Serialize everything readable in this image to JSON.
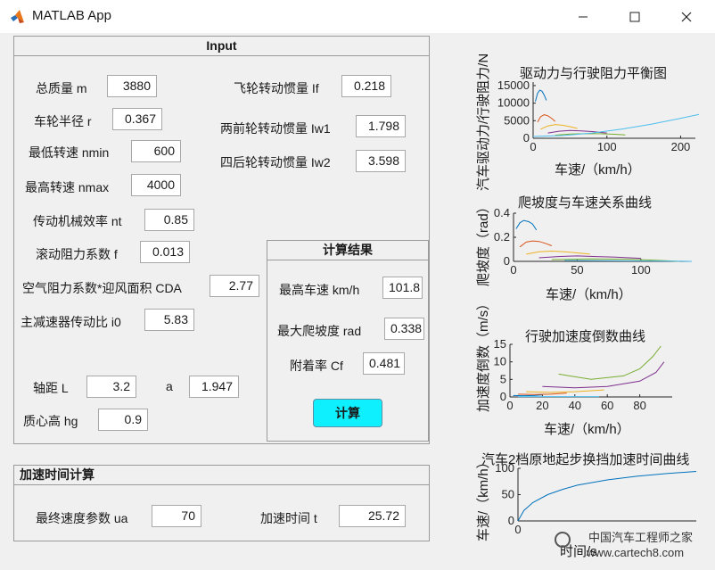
{
  "window": {
    "title": "MATLAB App",
    "minimize": "—",
    "maximize": "☐",
    "close": "✕"
  },
  "input_panel": {
    "title": "Input",
    "mass_label": "总质量 m",
    "mass": "3880",
    "wheel_radius_label": "车轮半径 r",
    "wheel_radius": "0.367",
    "nmin_label": "最低转速 nmin",
    "nmin": "600",
    "nmax_label": "最高转速 nmax",
    "nmax": "4000",
    "efficiency_label": "传动机械效率 nt",
    "efficiency": "0.85",
    "rolling_label": "滚动阻力系数 f",
    "rolling": "0.013",
    "cda_label": "空气阻力系数*迎风面积 CDA",
    "cda": "2.77",
    "i0_label": "主减速器传动比 i0",
    "i0": "5.83",
    "wheelbase_label": "轴距 L",
    "wheelbase": "3.2",
    "a_label": "a",
    "a": "1.947",
    "hg_label": "质心高 hg",
    "hg": "0.9",
    "flywheel_label": "飞轮转动惯量 If",
    "flywheel": "0.218",
    "front_inertia_label": "两前轮转动惯量 Iw1",
    "front_inertia": "1.798",
    "rear_inertia_label": "四后轮转动惯量 Iw2",
    "rear_inertia": "3.598"
  },
  "results_panel": {
    "title": "计算结果",
    "vmax_label": "最高车速 km/h",
    "vmax": "101.8",
    "grade_label": "最大爬坡度 rad",
    "grade": "0.338",
    "cf_label": "附着率 Cf",
    "cf": "0.481",
    "button": "计算"
  },
  "accel_panel": {
    "title": "加速时间计算",
    "ua_label": "最终速度参数 ua",
    "ua": "70",
    "time_label": "加速时间 t",
    "time": "25.72"
  },
  "colors": {
    "blue": "#0072bd",
    "orange": "#d95319",
    "yellow": "#edb120",
    "purple": "#7e2f8e",
    "green": "#77ac30",
    "cyan": "#4dbeee",
    "button": "#0ff0ff"
  },
  "chart_data": [
    {
      "type": "line",
      "title": "驱动力与行驶阻力平衡图",
      "xlabel": "车速/（km/h）",
      "ylabel": "汽车驱动力/行驶阻力/N",
      "xlim": [
        0,
        220
      ],
      "ylim": [
        0,
        16000
      ],
      "xticks": [
        "0",
        "100",
        "200"
      ],
      "yticks": [
        "0",
        "5000",
        "10000",
        "15000"
      ],
      "series": [
        {
          "color": "#0072bd",
          "x": [
            3,
            6,
            9,
            12,
            15,
            18
          ],
          "y": [
            10500,
            12800,
            13700,
            13400,
            12300,
            10800
          ]
        },
        {
          "color": "#d95319",
          "x": [
            6,
            10,
            15,
            20,
            25,
            30
          ],
          "y": [
            4600,
            6100,
            6700,
            6400,
            5700,
            4800
          ]
        },
        {
          "color": "#edb120",
          "x": [
            10,
            20,
            30,
            40,
            50,
            60
          ],
          "y": [
            2600,
            3500,
            3900,
            3700,
            3300,
            2800
          ]
        },
        {
          "color": "#7e2f8e",
          "x": [
            20,
            35,
            50,
            65,
            80,
            100
          ],
          "y": [
            1500,
            2000,
            2200,
            2100,
            1900,
            1500
          ]
        },
        {
          "color": "#77ac30",
          "x": [
            30,
            50,
            70,
            90,
            110,
            125
          ],
          "y": [
            900,
            1200,
            1300,
            1300,
            1150,
            950
          ]
        },
        {
          "color": "#4dbeee",
          "x": [
            0,
            40,
            80,
            120,
            160,
            200,
            225
          ],
          "y": [
            500,
            800,
            1500,
            2600,
            4000,
            5700,
            6800
          ]
        }
      ]
    },
    {
      "type": "line",
      "title": "爬坡度与车速关系曲线",
      "xlabel": "车速/（km/h）",
      "ylabel": "爬坡度（rad）",
      "xlim": [
        0,
        140
      ],
      "ylim": [
        0,
        0.4
      ],
      "xticks": [
        "0",
        "50",
        "100"
      ],
      "yticks": [
        "0",
        "0.2",
        "0.4"
      ],
      "series": [
        {
          "color": "#0072bd",
          "x": [
            2,
            5,
            8,
            12,
            15,
            18
          ],
          "y": [
            0.27,
            0.32,
            0.34,
            0.33,
            0.31,
            0.26
          ]
        },
        {
          "color": "#d95319",
          "x": [
            5,
            10,
            15,
            20,
            25,
            30
          ],
          "y": [
            0.12,
            0.16,
            0.17,
            0.165,
            0.15,
            0.13
          ]
        },
        {
          "color": "#edb120",
          "x": [
            10,
            20,
            30,
            40,
            50,
            60
          ],
          "y": [
            0.06,
            0.08,
            0.085,
            0.08,
            0.07,
            0.06
          ]
        },
        {
          "color": "#7e2f8e",
          "x": [
            20,
            35,
            50,
            65,
            80,
            100
          ],
          "y": [
            0.03,
            0.04,
            0.045,
            0.04,
            0.035,
            0.025
          ]
        },
        {
          "color": "#77ac30",
          "x": [
            30,
            60,
            90,
            110,
            125,
            130
          ],
          "y": [
            0.015,
            0.02,
            0.018,
            0.01,
            0.003,
            0.0
          ]
        },
        {
          "color": "#4dbeee",
          "x": [
            40,
            80,
            120,
            140
          ],
          "y": [
            0.008,
            0.006,
            0.003,
            0.0
          ]
        }
      ]
    },
    {
      "type": "line",
      "title": "行驶加速度倒数曲线",
      "xlabel": "车速/（km/h）",
      "ylabel": "加速度倒数（m/s）",
      "xlim": [
        0,
        100
      ],
      "ylim": [
        0,
        15
      ],
      "xticks": [
        "0",
        "20",
        "40",
        "60",
        "80"
      ],
      "yticks": [
        "0",
        "5",
        "10",
        "15"
      ],
      "series": [
        {
          "color": "#0072bd",
          "x": [
            2,
            8,
            15,
            20
          ],
          "y": [
            0.4,
            0.35,
            0.4,
            0.6
          ]
        },
        {
          "color": "#d95319",
          "x": [
            5,
            15,
            25,
            35
          ],
          "y": [
            0.8,
            0.7,
            0.8,
            1.1
          ]
        },
        {
          "color": "#edb120",
          "x": [
            10,
            25,
            40,
            58
          ],
          "y": [
            1.5,
            1.3,
            1.5,
            2.0
          ]
        },
        {
          "color": "#7e2f8e",
          "x": [
            20,
            40,
            60,
            80,
            90,
            95
          ],
          "y": [
            3.0,
            2.6,
            3.0,
            4.5,
            7.0,
            10.0
          ]
        },
        {
          "color": "#77ac30",
          "x": [
            30,
            50,
            70,
            80,
            88,
            93
          ],
          "y": [
            6.5,
            5.0,
            6.0,
            8.0,
            11.5,
            14.5
          ]
        },
        {
          "color": "#4dbeee",
          "x": [
            5,
            30,
            55
          ],
          "y": [
            0.1,
            0.1,
            0.1
          ]
        }
      ]
    },
    {
      "type": "line",
      "title": "汽车2档原地起步换挡加速时间曲线",
      "xlabel": "时间/s",
      "ylabel": "车速/（km/h）",
      "xlim": [
        0,
        60
      ],
      "ylim": [
        0,
        100
      ],
      "xticks": [
        "0"
      ],
      "yticks": [
        "0",
        "50",
        "100"
      ],
      "series": [
        {
          "color": "#0072bd",
          "x": [
            0,
            2,
            5,
            10,
            15,
            20,
            30,
            40,
            50,
            60
          ],
          "y": [
            0,
            20,
            35,
            50,
            60,
            68,
            78,
            85,
            90,
            94
          ]
        }
      ]
    }
  ],
  "watermark": {
    "line1": "中国汽车工程师之家",
    "line2": "www.cartech8.com"
  }
}
